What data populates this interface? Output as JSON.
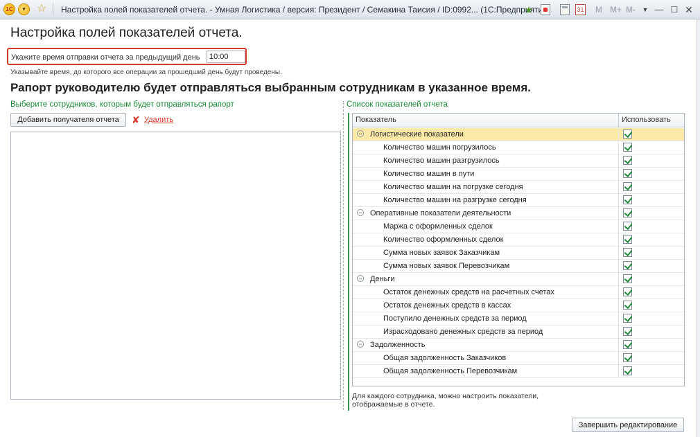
{
  "window": {
    "title": "Настройка полей показателей отчета. - Умная Логистика / версия: Президент / Семакина Таисия / ID:0992...   (1С:Предприятие)",
    "logo_text": "1С",
    "menu_glyph": "▾",
    "star_glyph": "☆",
    "calendar_text": "31",
    "m_buttons": [
      "M",
      "M+",
      "M-"
    ],
    "min_glyph": "—",
    "max_glyph": "☐",
    "close_glyph": "✕"
  },
  "page": {
    "title": "Настройка полей показателей отчета.",
    "time_label": "Укажите время отправки отчета за предыдущий день",
    "time_value": "10:00",
    "hint": "Указывайте время, до которого все операции за прошедший день будут проведены.",
    "headline": "Рапорт руководителю будет отправляться выбранным сотрудникам в указанное время."
  },
  "employees": {
    "label": "Выберите сотрудников, которым будет отправляться рапорт",
    "add_button": "Добавить получателя отчета",
    "delete_link": "Удалить"
  },
  "indicators": {
    "label": "Список показателей отчета",
    "col_indicator": "Показатель",
    "col_use": "Использовать",
    "rows": [
      {
        "type": "group",
        "label": "Логистические показатели",
        "checked": true,
        "selected": true
      },
      {
        "type": "item",
        "label": "Количество машин погрузилось",
        "checked": true
      },
      {
        "type": "item",
        "label": "Количество машин разгрузилось",
        "checked": true
      },
      {
        "type": "item",
        "label": "Количество машин в пути",
        "checked": true
      },
      {
        "type": "item",
        "label": "Количество машин на погрузке сегодня",
        "checked": true
      },
      {
        "type": "item",
        "label": "Количество машин на разгрузке сегодня",
        "checked": true
      },
      {
        "type": "group",
        "label": "Оперативные показатели деятельности",
        "checked": true
      },
      {
        "type": "item",
        "label": "Маржа с оформленных сделок",
        "checked": true
      },
      {
        "type": "item",
        "label": "Количество оформленных сделок",
        "checked": true
      },
      {
        "type": "item",
        "label": "Сумма новых заявок Заказчикам",
        "checked": true
      },
      {
        "type": "item",
        "label": "Сумма новых заявок Перевозчикам",
        "checked": true
      },
      {
        "type": "group",
        "label": "Деньги",
        "checked": true
      },
      {
        "type": "item",
        "label": "Остаток денежных средств на расчетных счетах",
        "checked": true
      },
      {
        "type": "item",
        "label": "Остаток денежных средств в кассах",
        "checked": true
      },
      {
        "type": "item",
        "label": "Поступило денежных средств за период",
        "checked": true
      },
      {
        "type": "item",
        "label": "Израсходовано денежных средств за период",
        "checked": true
      },
      {
        "type": "group",
        "label": "Задолженность",
        "checked": true
      },
      {
        "type": "item",
        "label": "Общая задолженность Заказчиков",
        "checked": true
      },
      {
        "type": "item",
        "label": "Общая задолженность Перевозчикам",
        "checked": true
      }
    ],
    "note": "Для каждого сотрудника, можно настроить показатели, отображаемые в отчете.",
    "toggle_glyph": "−"
  },
  "footer": {
    "finish_button": "Завершить редактирование"
  },
  "colors": {
    "accent_green": "#1d8c3a",
    "highlight_red": "#d93a2f",
    "selected_row": "#fbeaa7"
  }
}
